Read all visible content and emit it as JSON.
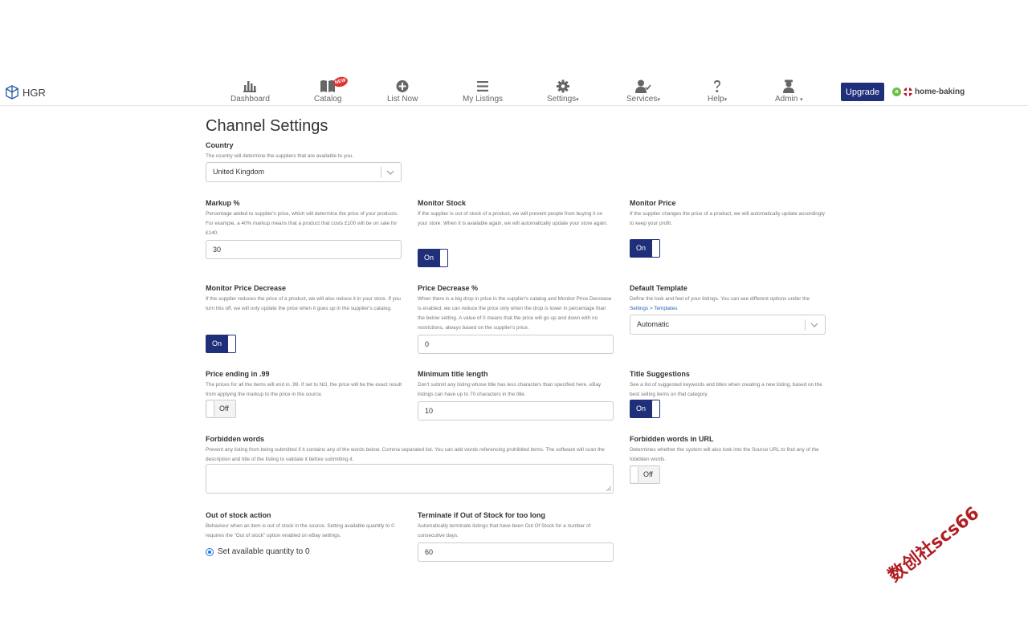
{
  "header": {
    "brand": "HGR",
    "nav": [
      {
        "label": "Dashboard",
        "icon": "bar-chart-icon"
      },
      {
        "label": "Catalog",
        "icon": "book-icon",
        "badge": "NEW"
      },
      {
        "label": "List Now",
        "icon": "plus-circle-icon"
      },
      {
        "label": "My Listings",
        "icon": "list-icon"
      },
      {
        "label": "Settings",
        "icon": "gear-icon",
        "caret": "▾"
      },
      {
        "label": "Services",
        "icon": "user-check-icon",
        "caret": "▾"
      },
      {
        "label": "Help",
        "icon": "question-icon",
        "caret": "▾"
      },
      {
        "label": "Admin",
        "icon": "admin-user-icon",
        "caret": "▾"
      }
    ],
    "upgrade_label": "Upgrade",
    "account_badge": "a",
    "account_name": "home-baking"
  },
  "page": {
    "title": "Channel Settings"
  },
  "settings": {
    "country": {
      "label": "Country",
      "desc": "The country will determine the suppliers that are available to you.",
      "value": "United Kingdom"
    },
    "markup": {
      "label": "Markup %",
      "desc": "Percentage added to supplier's price, which will determine the price of your products. For example, a 40% markup means that a product that costs £100 will be on sale for £140.",
      "value": "30"
    },
    "monitor_stock": {
      "label": "Monitor Stock",
      "desc": "If the supplier is out of stock of a product, we will prevent people from buying it on your store. When it is available again, we will automatically update your store again.",
      "state": "On"
    },
    "monitor_price": {
      "label": "Monitor Price",
      "desc": "If the supplier changes the price of a product, we will automatically update accordingly to keep your profit.",
      "state": "On"
    },
    "monitor_price_decrease": {
      "label": "Monitor Price Decrease",
      "desc": "If the supplier reduces the price of a product, we will also reduce it in your store. If you turn this off, we will only update the price when it goes up in the supplier's catalog.",
      "state": "On"
    },
    "price_decrease": {
      "label": "Price Decrease %",
      "desc": "When there is a big drop in price in the supplier's catalog and Monitor Price Decrease is enabled, we can reduce the price only when the drop is lower in percentage than the below setting. A value of 0 means that the price will go up and down with no restrictions, always based on the supplier's price.",
      "value": "0"
    },
    "default_template": {
      "label": "Default Template",
      "desc": "Define the look and feel of your listings. You can see different options under the",
      "link": "Settings > Templates",
      "value": "Automatic"
    },
    "price_ending": {
      "label": "Price ending in .99",
      "desc": "The prices for all the items will end in .99. If set to NO, the price will be the exact result from applying the markup to the price in the source.",
      "state": "Off"
    },
    "min_title_length": {
      "label": "Minimum title length",
      "desc": "Don't submit any listing whose title has less characters than specified here. eBay listings can have up to 70 characters in the title.",
      "value": "10"
    },
    "title_suggestions": {
      "label": "Title Suggestions",
      "desc": "See a list of suggested keywords and titles when creating a new listing, based on the best selling items on that category.",
      "state": "On"
    },
    "forbidden_words": {
      "label": "Forbidden words",
      "desc": "Prevent any listing from being submitted if it contains any of the words below. Comma separated list. You can add words referencing prohibited items. The software will scan the description and title of the listing to validate it before submitting it.",
      "value": ""
    },
    "forbidden_words_url": {
      "label": "Forbidden words in URL",
      "desc": "Determines whether the system will also look into the Source URL to find any of the fobidden words.",
      "state": "Off"
    },
    "out_of_stock_action": {
      "label": "Out of stock action",
      "desc": "Behaviour when an item is out of stock in the source. Setting available quantity to 0 requires the \"Out of stock\" option enabled on eBay settings.",
      "option_selected": "Set available quantity to 0"
    },
    "terminate_oos": {
      "label": "Terminate if Out of Stock for too long",
      "desc": "Automatically terminate listings that have been Out Of Stock for a number of consecutive days.",
      "value": "60"
    }
  },
  "watermark": "数创社scs66",
  "colors": {
    "primary": "#1f2f7a",
    "link": "#2b64b8",
    "badge_red": "#e0332f",
    "account_green": "#6cc04a"
  }
}
